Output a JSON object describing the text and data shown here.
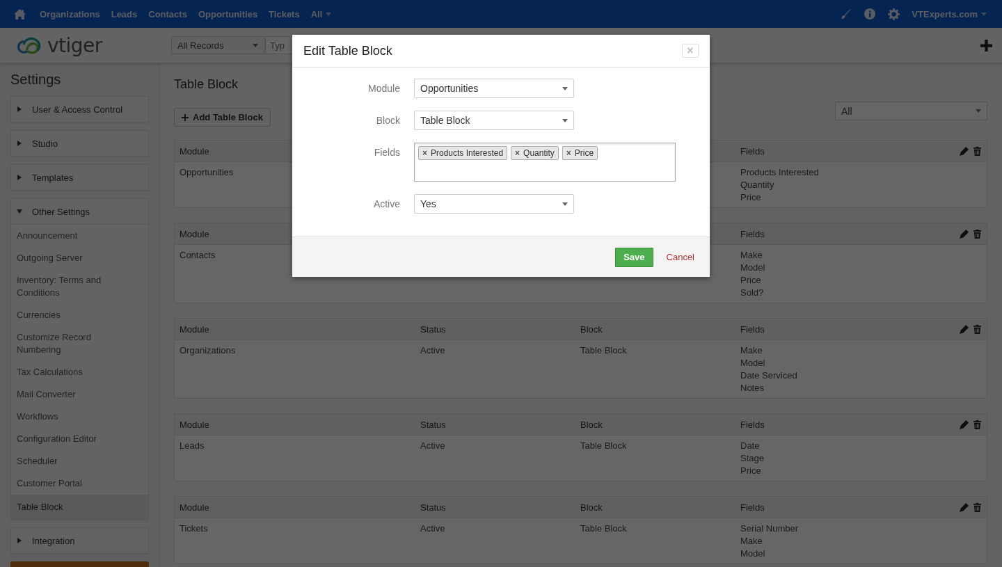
{
  "nav": {
    "items": [
      {
        "label": "Organizations"
      },
      {
        "label": "Leads"
      },
      {
        "label": "Contacts"
      },
      {
        "label": "Opportunities"
      },
      {
        "label": "Tickets"
      }
    ],
    "all_menu": "All",
    "user": "VTExperts.com"
  },
  "header": {
    "logo_text": "vtiger",
    "filter": "All Records",
    "search_placeholder": "Typ"
  },
  "sidebar": {
    "title": "Settings",
    "groups": [
      {
        "label": "User & Access Control",
        "expanded": false
      },
      {
        "label": "Studio",
        "expanded": false
      },
      {
        "label": "Templates",
        "expanded": false
      },
      {
        "label": "Other Settings",
        "expanded": true,
        "items": [
          {
            "label": "Announcement",
            "selected": false
          },
          {
            "label": "Outgoing Server",
            "selected": false
          },
          {
            "label": "Inventory: Terms and Conditions",
            "selected": false
          },
          {
            "label": "Currencies",
            "selected": false
          },
          {
            "label": "Customize Record Numbering",
            "selected": false
          },
          {
            "label": "Tax Calculations",
            "selected": false
          },
          {
            "label": "Mail Converter",
            "selected": false
          },
          {
            "label": "Workflows",
            "selected": false
          },
          {
            "label": "Configuration Editor",
            "selected": false
          },
          {
            "label": "Scheduler",
            "selected": false
          },
          {
            "label": "Customer Portal",
            "selected": false
          },
          {
            "label": "Table Block",
            "selected": true
          }
        ]
      },
      {
        "label": "Integration",
        "expanded": false
      }
    ]
  },
  "content": {
    "title": "Table Block",
    "add_button": "Add Table Block",
    "module_filter": "All",
    "tables": [
      {
        "header": {
          "module": "Module",
          "fields": "Fields"
        },
        "row": {
          "module": "Opportunities",
          "fields": [
            "Products Interested",
            "Quantity",
            "Price"
          ]
        }
      },
      {
        "header": {
          "module": "Module",
          "fields": "Fields"
        },
        "row": {
          "module": "Contacts",
          "fields": [
            "Make",
            "Model",
            "Price",
            "Sold?"
          ]
        }
      },
      {
        "header": {
          "module": "Module",
          "status": "Status",
          "block": "Block",
          "fields": "Fields"
        },
        "row": {
          "module": "Organizations",
          "status": "Active",
          "block": "Table Block",
          "fields": [
            "Make",
            "Model",
            "Date Serviced",
            "Notes"
          ]
        }
      },
      {
        "header": {
          "module": "Module",
          "status": "Status",
          "block": "Block",
          "fields": "Fields"
        },
        "row": {
          "module": "Leads",
          "status": "Active",
          "block": "Table Block",
          "fields": [
            "Date",
            "Stage",
            "Price"
          ]
        }
      },
      {
        "header": {
          "module": "Module",
          "status": "Status",
          "block": "Block",
          "fields": "Fields"
        },
        "row": {
          "module": "Tickets",
          "status": "Active",
          "block": "Table Block",
          "fields": [
            "Serial Number",
            "Make",
            "Model"
          ]
        }
      }
    ]
  },
  "modal": {
    "title": "Edit Table Block",
    "close": "×",
    "rows": [
      {
        "kind": "select",
        "label": "Module",
        "value": "Opportunities"
      },
      {
        "kind": "select",
        "label": "Block",
        "value": "Table Block"
      },
      {
        "kind": "tags",
        "label": "Fields",
        "tags": [
          {
            "remove": "×",
            "label": "Products Interested"
          },
          {
            "remove": "×",
            "label": "Quantity"
          },
          {
            "remove": "×",
            "label": "Price"
          }
        ]
      },
      {
        "kind": "select",
        "label": "Active",
        "value": "Yes"
      }
    ],
    "save": "Save",
    "cancel": "Cancel"
  }
}
